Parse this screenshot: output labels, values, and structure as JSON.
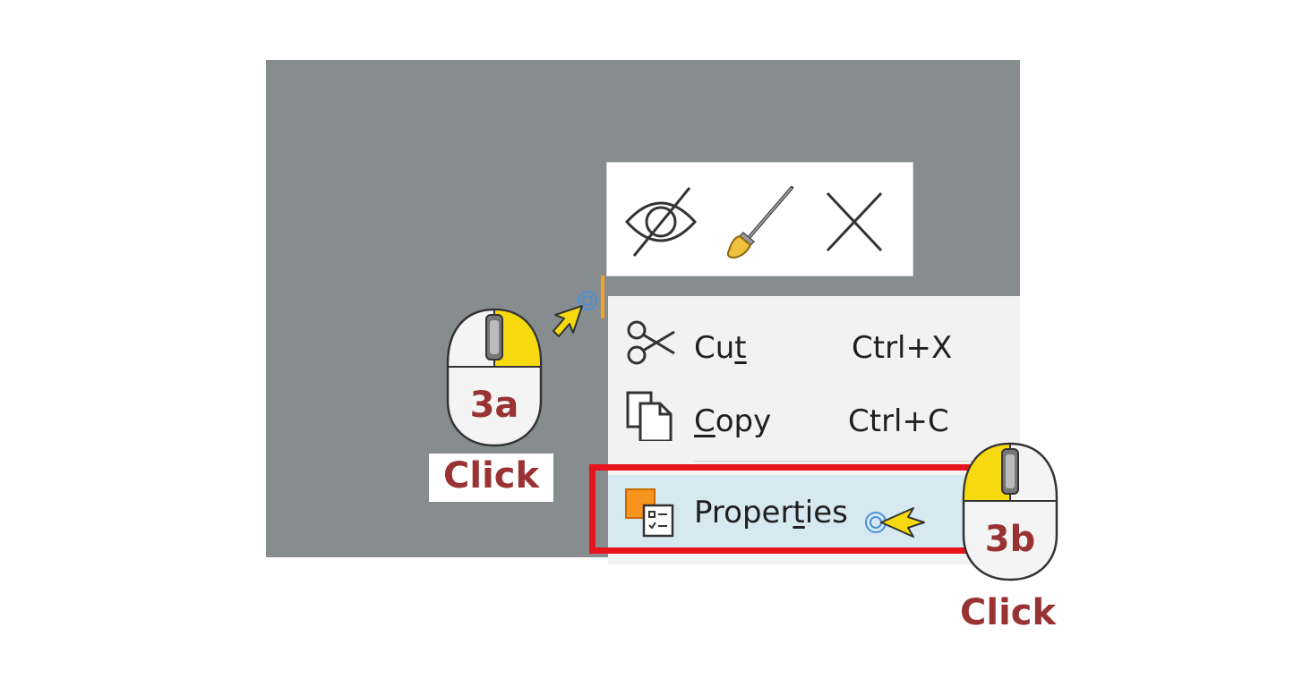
{
  "mini_toolbar": {
    "buttons": [
      {
        "icon": "hide-eye-icon"
      },
      {
        "icon": "paintbrush-icon"
      },
      {
        "icon": "close-x-icon"
      }
    ]
  },
  "context_menu": {
    "items": [
      {
        "label_pre": "Cu",
        "label_ul": "t",
        "label_post": "",
        "shortcut": "Ctrl+X",
        "icon": "scissors-icon"
      },
      {
        "label_pre": "",
        "label_ul": "C",
        "label_post": "opy",
        "shortcut": "Ctrl+C",
        "icon": "copy-icon"
      },
      {
        "label_pre": "Proper",
        "label_ul": "t",
        "label_post": "ies",
        "shortcut": "",
        "icon": "properties-icon"
      }
    ]
  },
  "annotations": {
    "step_a": {
      "label": "3a",
      "caption": "Click",
      "button": "right"
    },
    "step_b": {
      "label": "3b",
      "caption": "Click",
      "button": "left"
    }
  },
  "colors": {
    "canvas_bg": "#878d8f",
    "highlight": "#e8141d",
    "step_text": "#993333",
    "mouse_button": "#f6d90f",
    "selected_row": "#d6e8f0"
  }
}
